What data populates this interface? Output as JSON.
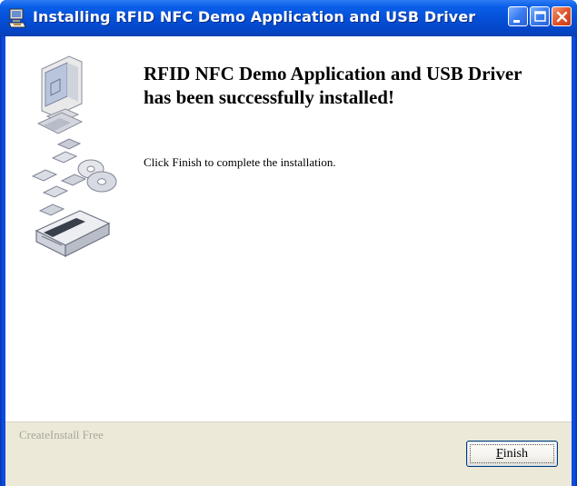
{
  "window": {
    "title": "Installing RFID NFC Demo Application and USB Driver",
    "icon": "installer-app-icon"
  },
  "titlebar_buttons": {
    "minimize": "minimize-icon",
    "maximize": "maximize-icon",
    "close": "close-icon"
  },
  "main": {
    "heading_line1": "RFID NFC Demo Application and USB Driver",
    "heading_line2": "has been successfully installed!",
    "instruction": "Click Finish to complete the installation.",
    "illustration": "computer-with-disks-illustration"
  },
  "footer": {
    "brand": "CreateInstall Free",
    "finish_label": "Finish",
    "finish_mnemonic": "F"
  },
  "colors": {
    "titlebar": "#0550d8",
    "close_button": "#e0552a",
    "footer_bg": "#ece9d8"
  }
}
